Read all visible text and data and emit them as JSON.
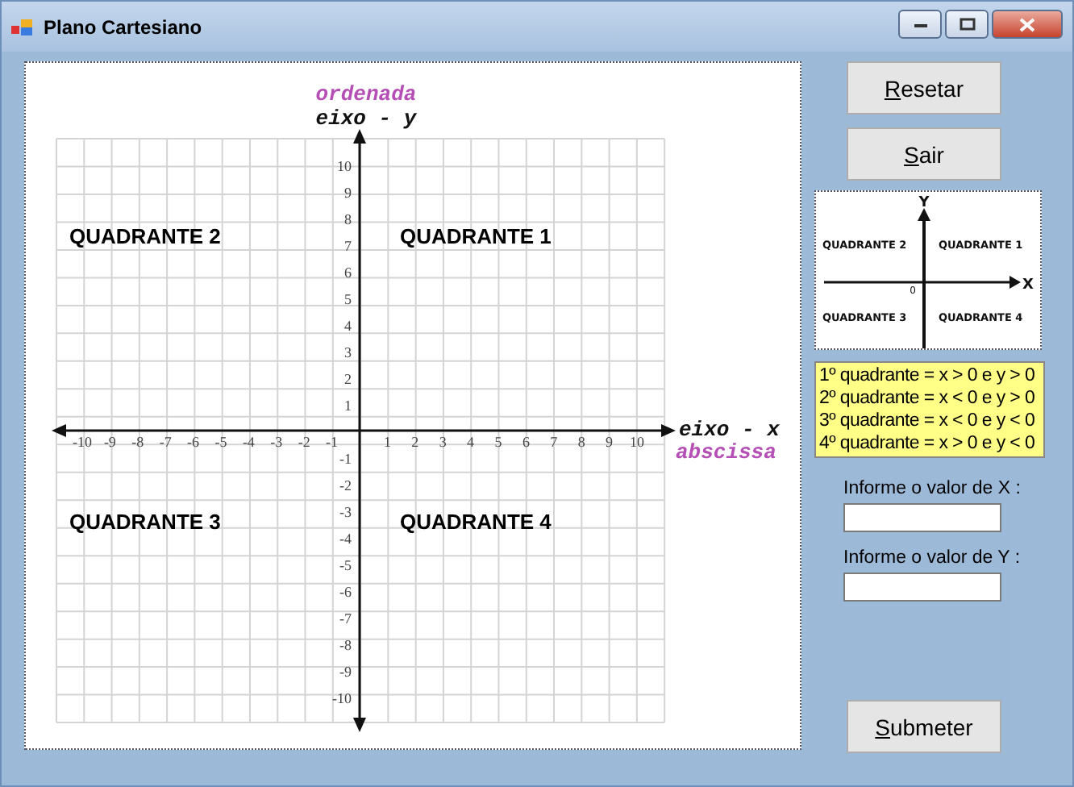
{
  "window": {
    "title": "Plano Cartesiano"
  },
  "plane": {
    "y_axis_caption": "ordenada",
    "y_axis_label": "eixo - y",
    "x_axis_label": "eixo - x",
    "x_axis_caption": "abscissa",
    "quadrant_labels": [
      "QUADRANTE 2",
      "QUADRANTE 1",
      "QUADRANTE 3",
      "QUADRANTE 4"
    ],
    "x_ticks": [
      "-10",
      "-9",
      "-8",
      "-7",
      "-6",
      "-5",
      "-4",
      "-3",
      "-2",
      "-1",
      "1",
      "2",
      "3",
      "4",
      "5",
      "6",
      "7",
      "8",
      "9",
      "10"
    ],
    "y_ticks": [
      "10",
      "9",
      "8",
      "7",
      "6",
      "5",
      "4",
      "3",
      "2",
      "1",
      "-1",
      "-2",
      "-3",
      "-4",
      "-5",
      "-6",
      "-7",
      "-8",
      "-9",
      "-10"
    ]
  },
  "top_buttons": [
    "Resetar",
    "Sair"
  ],
  "legend_image": {
    "axis_y": "Y",
    "axis_x": "X",
    "origin": "0",
    "quadrant_labels": [
      "QUADRANTE 2",
      "QUADRANTE 1",
      "QUADRANTE 3",
      "QUADRANTE 4"
    ]
  },
  "rules": [
    "1º quadrante = x > 0 e y > 0",
    "2º quadrante = x < 0 e y > 0",
    "3º quadrante = x < 0 e y < 0",
    "4º quadrante = x > 0 e y < 0"
  ],
  "fields": [
    {
      "label": "Informe o valor de X :"
    },
    {
      "label": "Informe o valor de Y :"
    }
  ],
  "submit_button": "Submeter"
}
